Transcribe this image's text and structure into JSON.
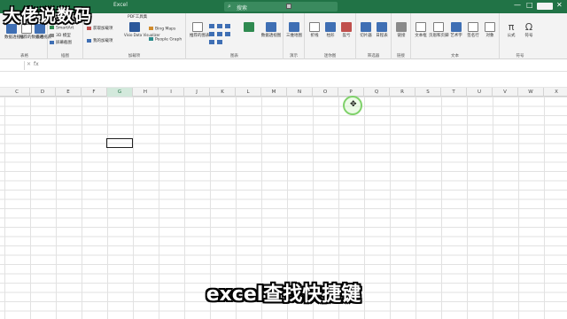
{
  "titlebar": {
    "doc_title": "Excel",
    "search_placeholder": "搜索",
    "controls": [
      "—",
      "□",
      "✕"
    ]
  },
  "ribbon": {
    "groups": [
      {
        "id": "tables",
        "label": "表格",
        "buttons": [
          "数据透视表",
          "推荐的数据透视表",
          "表格"
        ]
      },
      {
        "id": "illustrations",
        "label": "插图",
        "buttons": [
          "图片",
          "形状",
          "图标"
        ],
        "small": [
          "SmartArt",
          "3D 模型",
          "屏幕截图"
        ]
      },
      {
        "id": "addins",
        "label": "加载项",
        "small": [
          "获取加载项",
          "我的加载项"
        ],
        "extra": [
          "PDF工具集",
          "Bing Maps",
          "People Graph",
          "Visio Data Visualizer"
        ]
      },
      {
        "id": "charts",
        "label": "图表",
        "buttons": [
          "推荐的图表",
          "数据透视图"
        ]
      },
      {
        "id": "tours",
        "label": "演示",
        "buttons": [
          "三维地图"
        ]
      },
      {
        "id": "sparklines",
        "label": "迷你图",
        "buttons": [
          "折线",
          "柱形",
          "盈亏"
        ]
      },
      {
        "id": "filters",
        "label": "筛选器",
        "buttons": [
          "切片器",
          "日程表"
        ]
      },
      {
        "id": "links",
        "label": "链接",
        "buttons": [
          "链接"
        ]
      },
      {
        "id": "text",
        "label": "文本",
        "buttons": [
          "文本框",
          "页眉和页脚",
          "艺术字",
          "签名行",
          "对象"
        ]
      },
      {
        "id": "symbols",
        "label": "符号",
        "buttons": [
          "公式",
          "符号"
        ]
      }
    ]
  },
  "formula_bar": {
    "fx": "fx",
    "cancel": "✕"
  },
  "sheet": {
    "columns": [
      "C",
      "D",
      "E",
      "F",
      "G",
      "H",
      "I",
      "J",
      "K",
      "L",
      "M",
      "N",
      "O",
      "P",
      "Q",
      "R",
      "S",
      "T",
      "U",
      "V",
      "W",
      "X"
    ],
    "active_column": "G",
    "selected_cell": "G"
  },
  "overlay": {
    "watermark": "大佬说数码",
    "subtitle": "excel查找快捷键"
  }
}
